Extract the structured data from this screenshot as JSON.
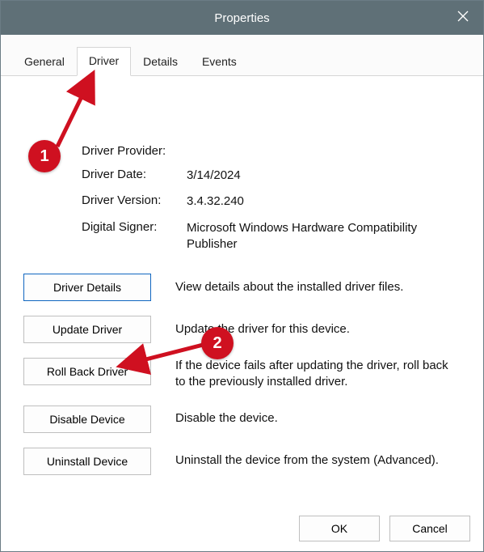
{
  "window": {
    "title": "Properties"
  },
  "tabs": [
    "General",
    "Driver",
    "Details",
    "Events"
  ],
  "active_tab_index": 1,
  "info": {
    "rows": [
      {
        "label": "Driver Provider:",
        "value": ""
      },
      {
        "label": "Driver Date:",
        "value": "3/14/2024"
      },
      {
        "label": "Driver Version:",
        "value": "3.4.32.240"
      },
      {
        "label": "Digital Signer:",
        "value": "Microsoft Windows Hardware Compatibility Publisher"
      }
    ]
  },
  "actions": [
    {
      "button": "Driver Details",
      "desc": "View details about the installed driver files.",
      "accent": true
    },
    {
      "button": "Update Driver",
      "desc": "Update the driver for this device."
    },
    {
      "button": "Roll Back Driver",
      "desc": "If the device fails after updating the driver, roll back to the previously installed driver."
    },
    {
      "button": "Disable Device",
      "desc": "Disable the device."
    },
    {
      "button": "Uninstall Device",
      "desc": "Uninstall the device from the system (Advanced)."
    }
  ],
  "footer": {
    "ok": "OK",
    "cancel": "Cancel"
  },
  "annotations": {
    "badge1": "1",
    "badge2": "2"
  }
}
